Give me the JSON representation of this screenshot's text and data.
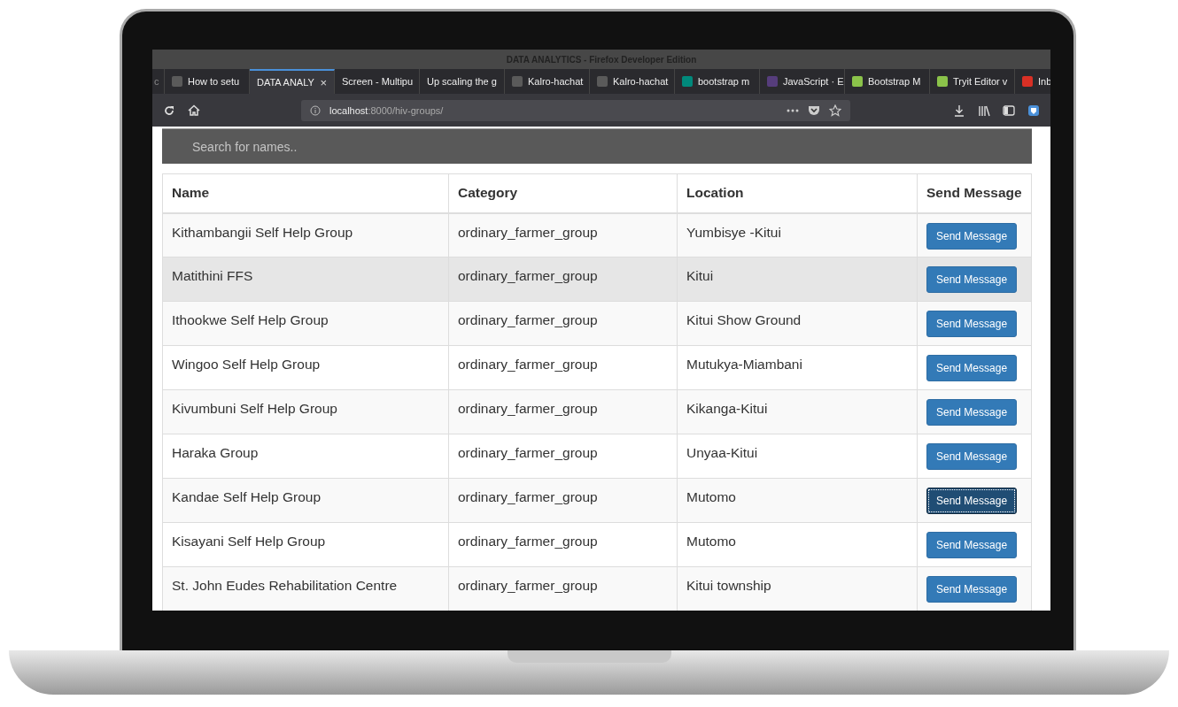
{
  "window": {
    "title": "DATA ANALYTICS - Firefox Developer Edition"
  },
  "tabs": [
    {
      "label": "c",
      "selected": false
    },
    {
      "label": "How to setu",
      "selected": false,
      "color": "#5a5a5a"
    },
    {
      "label": "DATA ANALY",
      "selected": true,
      "close": "×"
    },
    {
      "label": "Screen - Multipu",
      "selected": false
    },
    {
      "label": "Up scaling the g",
      "selected": false
    },
    {
      "label": "Kalro-hachat",
      "selected": false,
      "color": "#5a5a5a"
    },
    {
      "label": "Kalro-hachat",
      "selected": false,
      "color": "#5a5a5a"
    },
    {
      "label": "bootstrap m",
      "selected": false,
      "color": "#00897b"
    },
    {
      "label": "JavaScript · E",
      "selected": false,
      "color": "#563d7c"
    },
    {
      "label": "Bootstrap M",
      "selected": false,
      "color": "#8bc34a"
    },
    {
      "label": "Tryit Editor v",
      "selected": false,
      "color": "#8bc34a"
    },
    {
      "label": "Inb",
      "selected": false,
      "color": "#d93025"
    }
  ],
  "address_bar": {
    "host": "localhost",
    "path": ":8000/hiv-groups/"
  },
  "search": {
    "placeholder": "Search for names.."
  },
  "table": {
    "columns": [
      "Name",
      "Category",
      "Location",
      "Send Message"
    ],
    "rows": [
      {
        "cells": [
          "Kithambangii Self Help Group",
          "ordinary_farmer_group",
          "Yumbisye -Kitui"
        ],
        "button": "Send Message",
        "hovered": false,
        "focused": false
      },
      {
        "cells": [
          "Matithini FFS",
          "ordinary_farmer_group",
          "Kitui"
        ],
        "button": "Send Message",
        "hovered": true,
        "focused": false
      },
      {
        "cells": [
          "Ithookwe Self Help Group",
          "ordinary_farmer_group",
          "Kitui Show Ground"
        ],
        "button": "Send Message",
        "hovered": false,
        "focused": false
      },
      {
        "cells": [
          "Wingoo Self Help Group",
          "ordinary_farmer_group",
          "Mutukya-Miambani"
        ],
        "button": "Send Message",
        "hovered": false,
        "focused": false
      },
      {
        "cells": [
          "Kivumbuni Self Help Group",
          "ordinary_farmer_group",
          "Kikanga-Kitui"
        ],
        "button": "Send Message",
        "hovered": false,
        "focused": false
      },
      {
        "cells": [
          "Haraka Group",
          "ordinary_farmer_group",
          "Unyaa-Kitui"
        ],
        "button": "Send Message",
        "hovered": false,
        "focused": false
      },
      {
        "cells": [
          "Kandae Self Help Group",
          "ordinary_farmer_group",
          "Mutomo"
        ],
        "button": "Send Message",
        "hovered": false,
        "focused": true
      },
      {
        "cells": [
          "Kisayani Self Help Group",
          "ordinary_farmer_group",
          "Mutomo"
        ],
        "button": "Send Message",
        "hovered": false,
        "focused": false
      },
      {
        "cells": [
          "St. John Eudes Rehabilitation Centre",
          "ordinary_farmer_group",
          "Kitui township"
        ],
        "button": "Send Message",
        "hovered": false,
        "focused": false
      }
    ]
  }
}
